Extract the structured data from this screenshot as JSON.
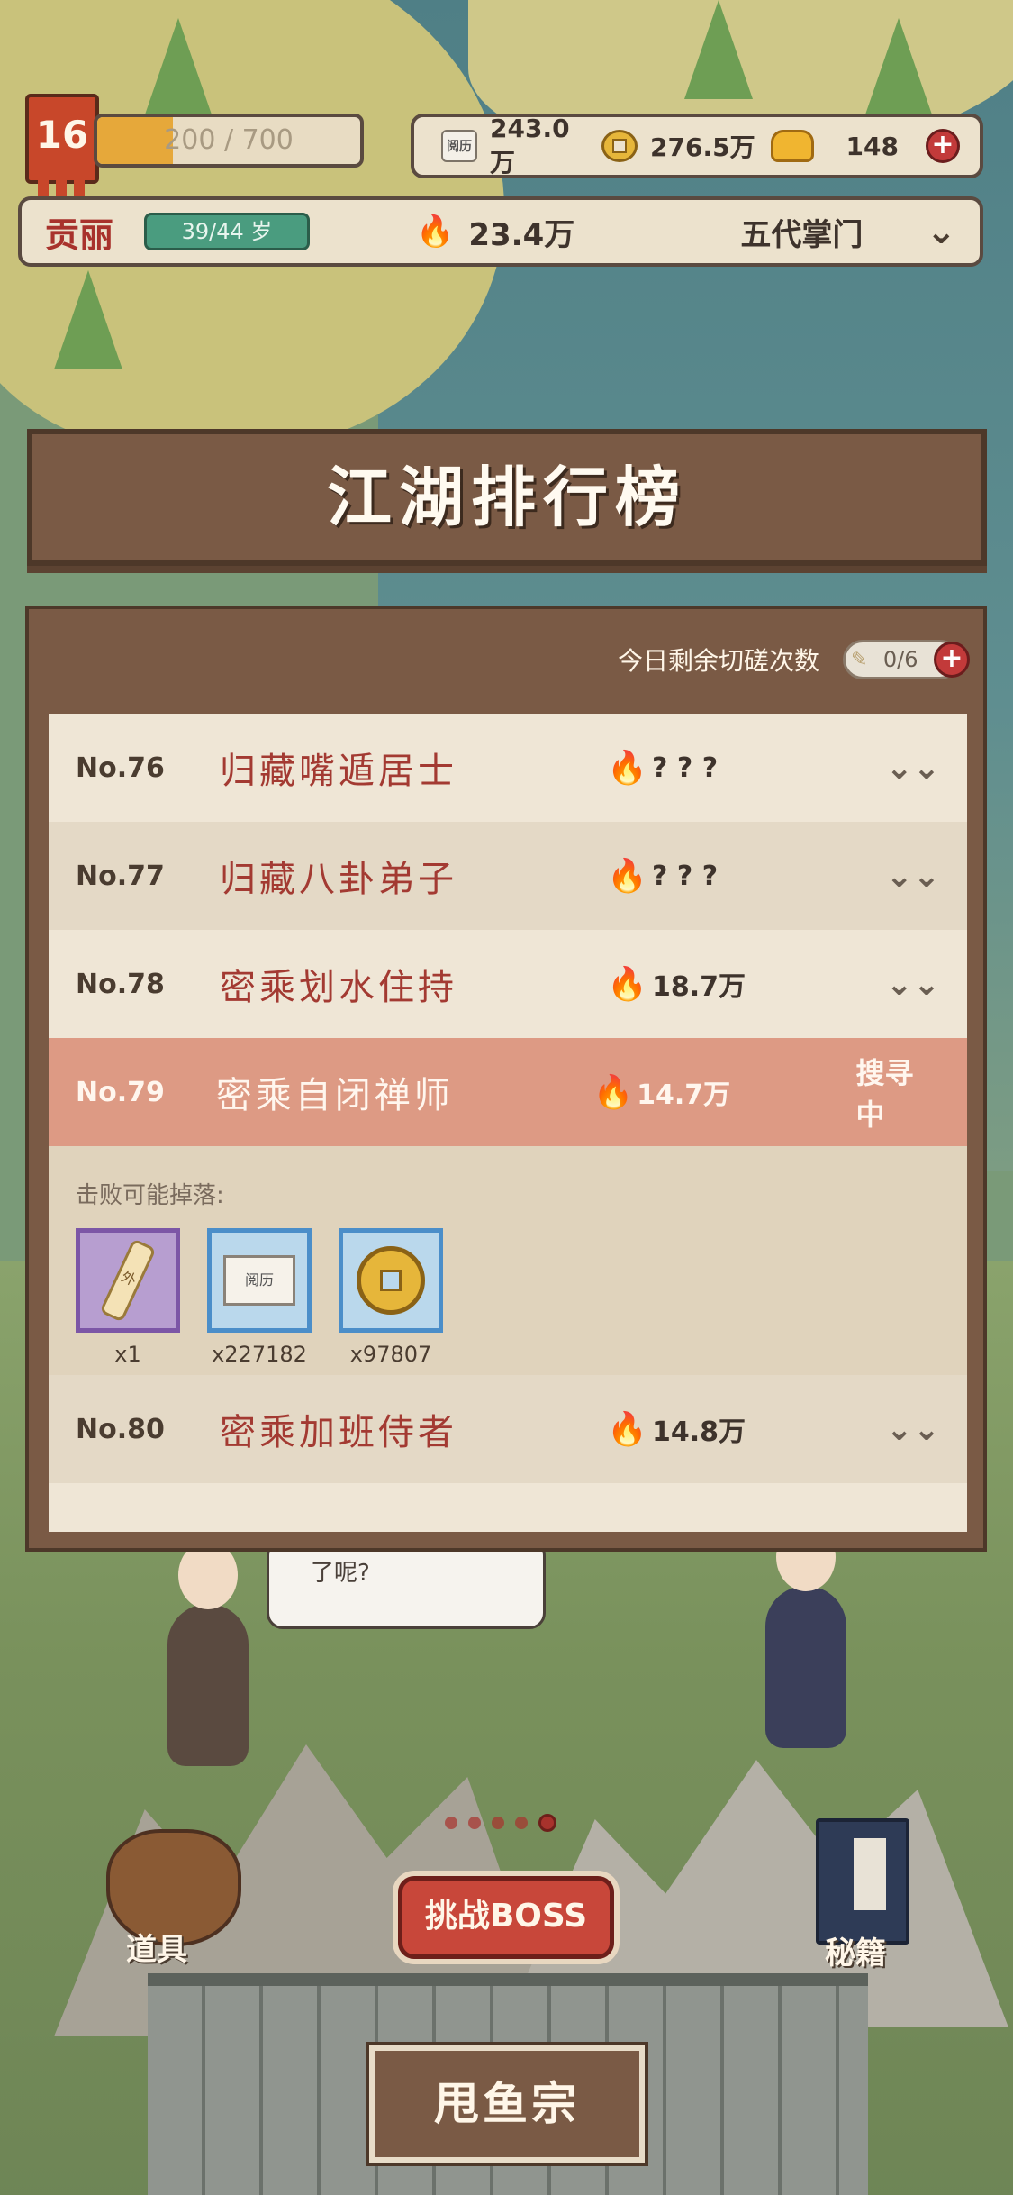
{
  "hud": {
    "level": "16",
    "exp_text": "200 / 700",
    "exp_progress": 0.286,
    "resources": {
      "yueli": "243.0万",
      "coins": "276.5万",
      "gold": "148"
    },
    "book_icon_text": "阅历",
    "plus": "+"
  },
  "player": {
    "name": "贡丽",
    "age": "39/44 岁",
    "power": "23.4万",
    "sect_title": "五代掌门",
    "chevron": "⌄"
  },
  "ranking": {
    "title": "江湖排行榜",
    "remaining_label": "今日剩余切磋次数",
    "remaining_value": "0/6",
    "plus": "+",
    "rows": [
      {
        "no": "No.76",
        "name": "归藏嘴遁居士",
        "power": "? ? ?",
        "action": "⌄⌄"
      },
      {
        "no": "No.77",
        "name": "归藏八卦弟子",
        "power": "? ? ?",
        "action": "⌄⌄"
      },
      {
        "no": "No.78",
        "name": "密乘划水住持",
        "power": "18.7万",
        "action": "⌄⌄"
      },
      {
        "no": "No.79",
        "name": "密乘自闭禅师",
        "power": "14.7万",
        "action": "搜寻中"
      },
      {
        "no": "No.80",
        "name": "密乘加班侍者",
        "power": "14.8万",
        "action": "⌄⌄"
      }
    ],
    "drops": {
      "label": "击败可能掉落:",
      "items": [
        {
          "icon": "scroll-icon",
          "icon_text": "外",
          "qty": "x1",
          "rarity_color": "#7c56a6"
        },
        {
          "icon": "yueli-book-icon",
          "icon_text": "阅历",
          "qty": "x227182",
          "rarity_color": "#4b8ec9"
        },
        {
          "icon": "coin-icon",
          "icon_text": "",
          "qty": "x97807",
          "rarity_color": "#4b8ec9"
        }
      ]
    }
  },
  "scene": {
    "bubble_text": "了呢?"
  },
  "bottom": {
    "items_label": "道具",
    "boss_label": "挑战BOSS",
    "secrets_label": "秘籍",
    "sect_name": "甩鱼宗",
    "page_dots": 5,
    "active_dot": 5
  },
  "colors": {
    "accent_red": "#a33a32",
    "active_row": "#dd9a84",
    "panel_brown": "#7a5a45",
    "fire": "#e0462a"
  }
}
